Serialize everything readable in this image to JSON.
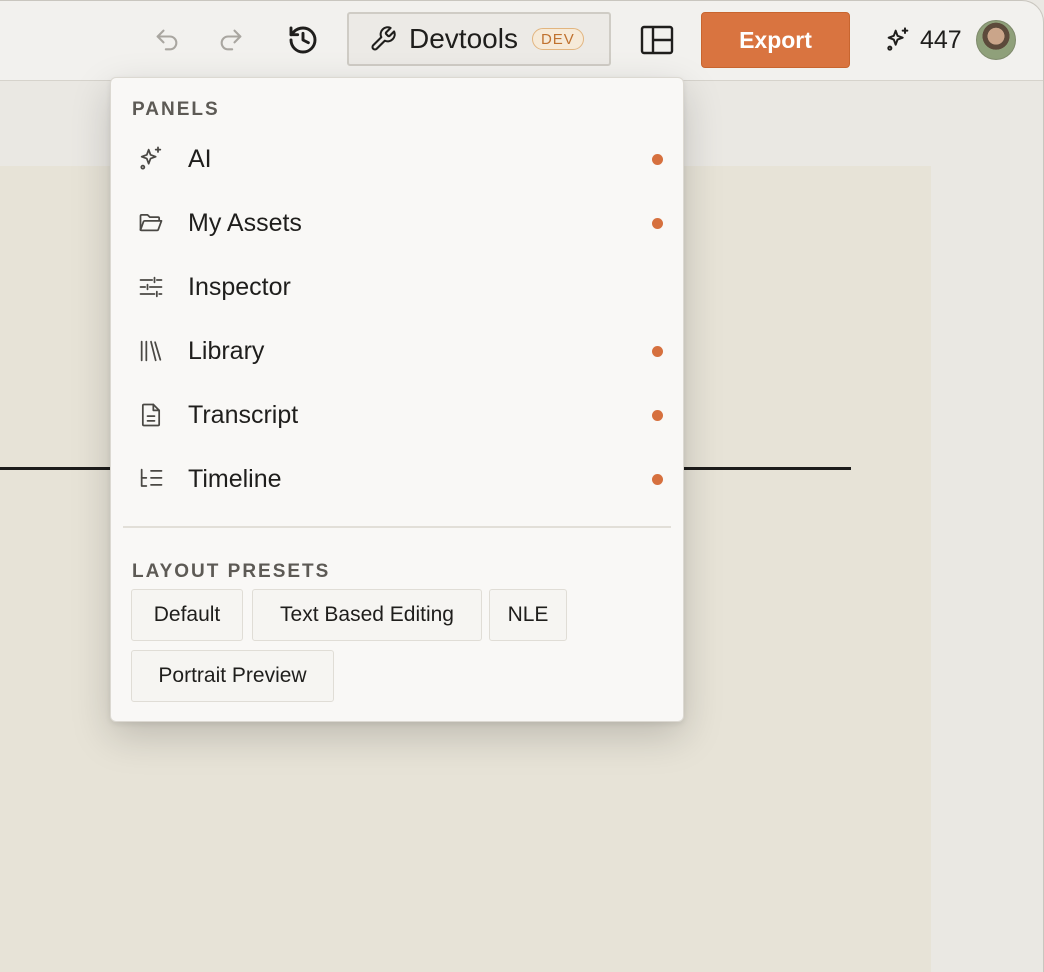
{
  "toolbar": {
    "devtools_label": "Devtools",
    "dev_badge": "DEV",
    "export_label": "Export",
    "credits": "447"
  },
  "menu": {
    "panels_heading": "PANELS",
    "panels": [
      {
        "label": "AI",
        "icon": "sparkles-icon",
        "active": true
      },
      {
        "label": "My Assets",
        "icon": "folder-open-icon",
        "active": true
      },
      {
        "label": "Inspector",
        "icon": "sliders-icon",
        "active": false
      },
      {
        "label": "Library",
        "icon": "library-icon",
        "active": true
      },
      {
        "label": "Transcript",
        "icon": "document-icon",
        "active": true
      },
      {
        "label": "Timeline",
        "icon": "timeline-icon",
        "active": true
      }
    ],
    "presets_heading": "LAYOUT PRESETS",
    "presets": [
      "Default",
      "Text Based Editing",
      "NLE",
      "Portrait Preview"
    ]
  },
  "colors": {
    "accent": "#d97440",
    "active_dot": "#d6703e"
  }
}
